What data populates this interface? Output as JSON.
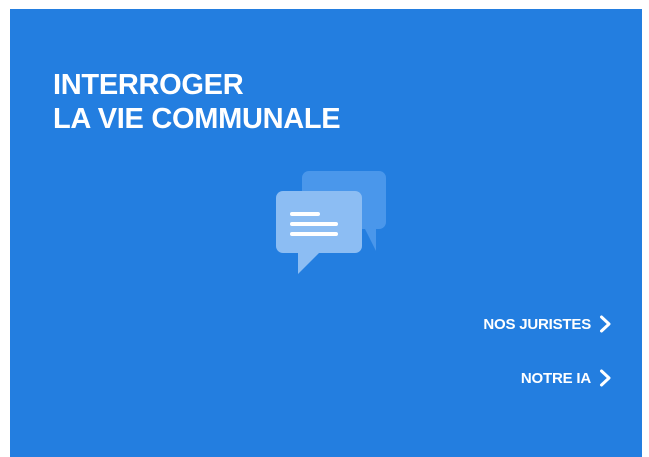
{
  "card": {
    "background": "#237ee0",
    "title_lines": [
      "INTERROGER",
      "LA VIE COMMUNALE"
    ]
  },
  "icon": {
    "name": "chat-bubbles-icon",
    "back_bubble_color": "#4a97eb",
    "front_bubble_color": "#8cbdf3",
    "lines_color": "#ffffff"
  },
  "links": [
    {
      "label": "NOS JURISTES",
      "icon": "chevron-right-icon"
    },
    {
      "label": "NOTRE IA",
      "icon": "chevron-right-icon"
    }
  ]
}
